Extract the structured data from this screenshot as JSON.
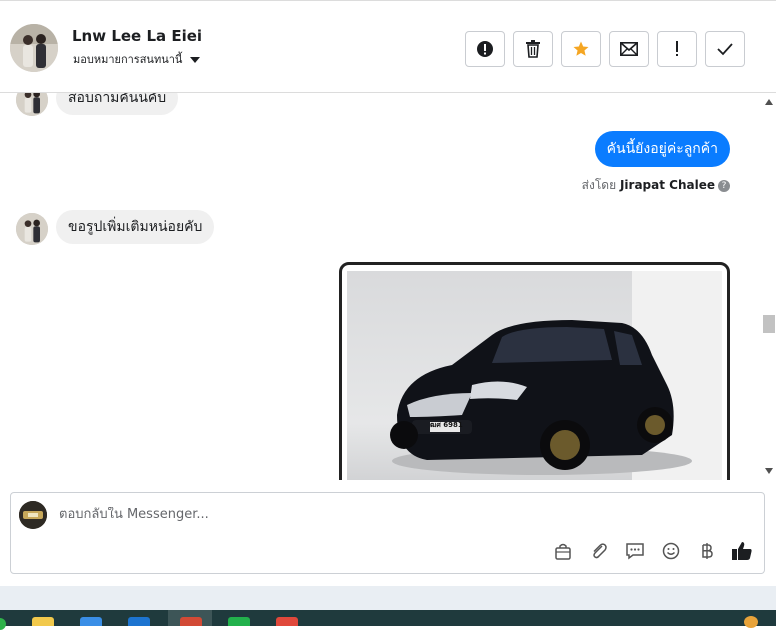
{
  "header": {
    "contact_name": "Lnw Lee La Eiei",
    "assign_label": "มอบหมายการสนทนานี้",
    "tools": [
      {
        "name": "spam-button",
        "icon": "exclamation-circle-icon"
      },
      {
        "name": "delete-button",
        "icon": "trash-icon"
      },
      {
        "name": "star-button",
        "icon": "star-icon"
      },
      {
        "name": "mark-unread-button",
        "icon": "envelope-icon"
      },
      {
        "name": "follow-up-button",
        "icon": "exclamation-icon"
      },
      {
        "name": "mark-done-button",
        "icon": "check-icon"
      }
    ]
  },
  "thread": {
    "msg1": "สอบถามคันนี้คับ",
    "msg2": "คันนี้ยังอยู่ค่ะลูกค้า",
    "sent_by_prefix": "ส่งโดย",
    "sent_by_name": "Jirapat Chalee",
    "msg3": "ขอรูปเพิ่มเติมหน่อยคับ",
    "plate_text": "ฒศ 6981"
  },
  "composer": {
    "placeholder": "ตอบกลับใน Messenger...",
    "icons": [
      "bag-icon",
      "paperclip-icon",
      "quick-reply-icon",
      "emoji-icon",
      "baht-icon",
      "thumbs-up-icon"
    ]
  },
  "colors": {
    "accent": "#0a7cff",
    "star": "#f5a623"
  }
}
